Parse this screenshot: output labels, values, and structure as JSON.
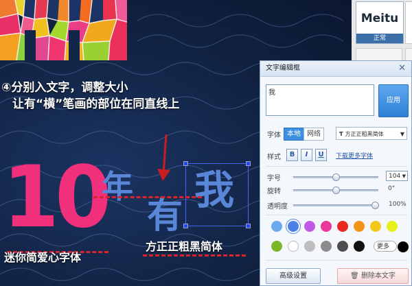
{
  "canvas": {
    "step_line1": "④分别入文字，调整大小",
    "step_line2": "让有“横”笔画的部位在同直线上",
    "big_number": "10",
    "char_nian": "年",
    "char_you": "有",
    "char_wo": "我",
    "label_left": "迷你简爱心字体",
    "label_right": "方正正粗黑简体",
    "colors": {
      "pink": "#f0307a",
      "blue_char": "#5a86d8",
      "dash_red": "#d8242a",
      "selection": "#4a66ff"
    }
  },
  "templates": {
    "thumb_text": "Meitu",
    "thumb_caption": "正常"
  },
  "dialog": {
    "title": "文字编辑框",
    "text_value": "我",
    "apply_label": "应用",
    "font_label": "字体",
    "font_tab_local": "本地",
    "font_tab_network": "网络",
    "font_icon": "Ƭ",
    "font_selected": "方正正粗黑简体",
    "style_label": "样式",
    "bold": "B",
    "italic": "I",
    "underline": "U",
    "download_more_fonts": "下载更多字体",
    "size_label": "字号",
    "size_value": "104",
    "size_fraction": 0.5,
    "rotate_label": "旋转",
    "rotate_value": "0°",
    "rotate_fraction": 0.5,
    "opacity_label": "透明度",
    "opacity_value": "100%",
    "opacity_fraction": 1.0,
    "swatches_row1": [
      "#6aa8f0",
      "#4a80e8",
      "#c05ae6",
      "#e8389a",
      "#e82a22",
      "#f29418",
      "#f4c81a",
      "#e8f01a"
    ],
    "swatches_row2": [
      "#7ab82a",
      "#ffffff",
      "#bdbdbd",
      "#8c8c8c",
      "#4e4e4e",
      "#111111"
    ],
    "more_label": "更多",
    "advanced_label": "高级设置",
    "delete_label": "删除本文字"
  }
}
